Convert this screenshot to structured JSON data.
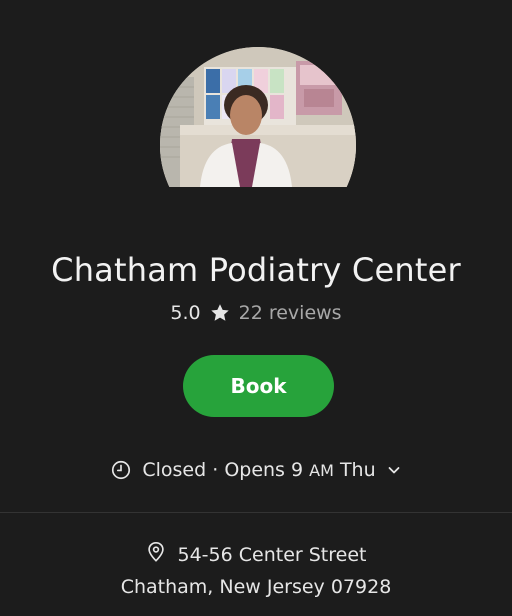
{
  "business": {
    "name": "Chatham Podiatry Center",
    "rating": "5.0",
    "reviews": "22 reviews"
  },
  "actions": {
    "book_label": "Book"
  },
  "hours": {
    "status": "Closed",
    "separator": "·",
    "opens_prefix": "Opens 9",
    "opens_ampm": "AM",
    "opens_day": "Thu"
  },
  "address": {
    "street": "54-56 Center Street",
    "city_line": "Chatham, New Jersey 07928"
  },
  "colors": {
    "background": "#1c1c1c",
    "book_button": "#27a33b",
    "secondary_text": "#a8a8a8"
  },
  "icons": {
    "rating": "star-icon",
    "hours": "clock-icon",
    "hours_toggle": "chevron-down-icon",
    "address": "location-pin-icon"
  }
}
